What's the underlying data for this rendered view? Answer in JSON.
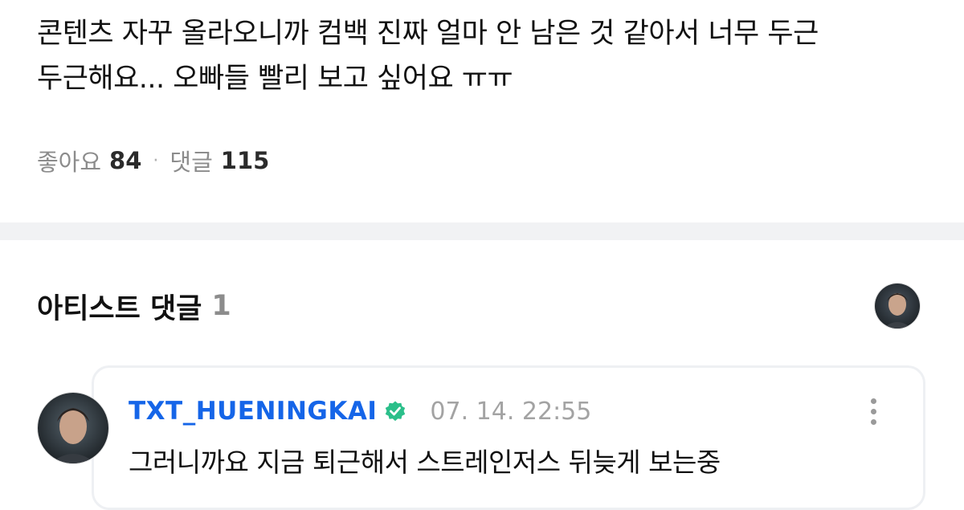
{
  "post": {
    "text_line1": "콘텐츠 자꾸 올라오니까 컴백 진짜 얼마 안 남은 것 같아서 너무 두근",
    "text_line2": "두근해요... 오빠들 빨리 보고 싶어요 ㅠㅠ"
  },
  "stats": {
    "like_label": "좋아요",
    "like_count": "84",
    "separator": "·",
    "comment_label": "댓글",
    "comment_count": "115"
  },
  "artist_comments": {
    "title": "아티스트 댓글",
    "count": "1",
    "comment": {
      "author": "TXT_HUENINGKAI",
      "verified_icon": "verified-check-icon",
      "timestamp": "07. 14. 22:55",
      "text": "그러니까요 지금 퇴근해서 스트레인저스 뒤늦게 보는중",
      "more_icon": "more-vertical-icon"
    }
  },
  "colors": {
    "author": "#1565e8",
    "muted": "#8c8c8c",
    "divider": "#f1f2f4"
  }
}
